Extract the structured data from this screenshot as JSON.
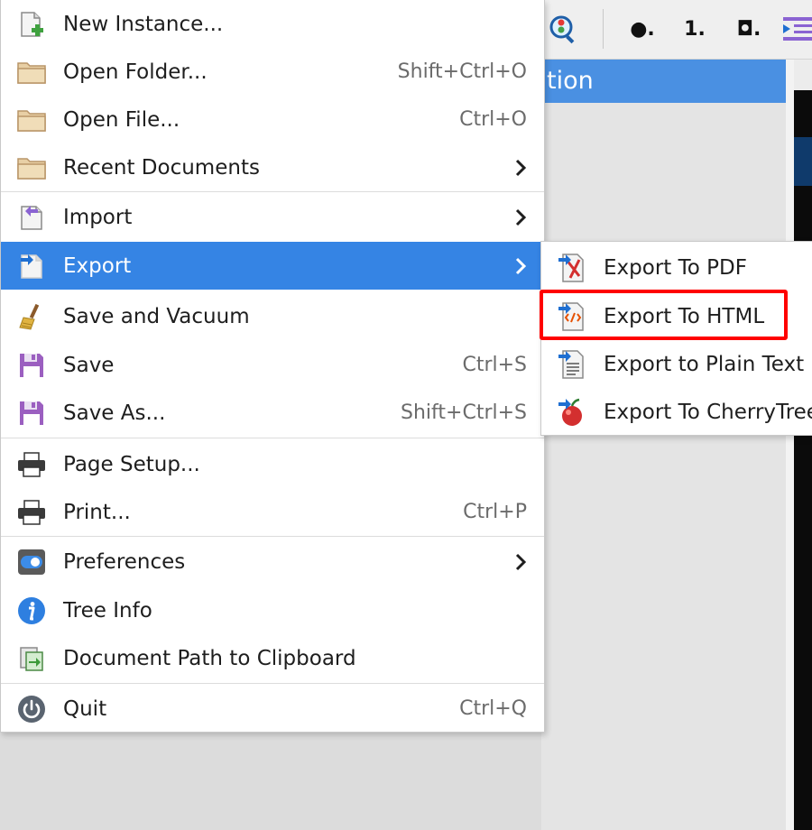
{
  "background": {
    "tree_header_text": "tion",
    "toolbar_icons": [
      "bullet-list-icon",
      "numbered-list-icon",
      "todo-list-icon",
      "indent-icon"
    ],
    "toolbar_glyphs": {
      "bullet": "●.",
      "numbered": "1.",
      "todo": "◘."
    }
  },
  "menu": {
    "items": [
      {
        "label": "New Instance...",
        "accel": "",
        "icon": "new-instance-icon"
      },
      {
        "label": "Open Folder...",
        "accel": "Shift+Ctrl+O",
        "icon": "folder-icon"
      },
      {
        "label": "Open File...",
        "accel": "Ctrl+O",
        "icon": "folder-icon"
      },
      {
        "label": "Recent Documents",
        "accel": "",
        "icon": "folder-icon",
        "submenu": true
      },
      {
        "label": "Import",
        "accel": "",
        "icon": "import-icon",
        "submenu": true
      },
      {
        "label": "Export",
        "accel": "",
        "icon": "export-icon",
        "submenu": true,
        "active": true
      },
      {
        "label": "Save and Vacuum",
        "accel": "",
        "icon": "broom-icon"
      },
      {
        "label": "Save",
        "accel": "Ctrl+S",
        "icon": "floppy-disk-icon"
      },
      {
        "label": "Save As...",
        "accel": "Shift+Ctrl+S",
        "icon": "floppy-disk-icon"
      },
      {
        "label": "Page Setup...",
        "accel": "",
        "icon": "printer-icon"
      },
      {
        "label": "Print...",
        "accel": "Ctrl+P",
        "icon": "printer-icon"
      },
      {
        "label": "Preferences",
        "accel": "",
        "icon": "preferences-toggle-icon",
        "submenu": true
      },
      {
        "label": "Tree Info",
        "accel": "",
        "icon": "info-icon"
      },
      {
        "label": "Document Path to Clipboard",
        "accel": "",
        "icon": "clipboard-icon"
      },
      {
        "label": "Quit",
        "accel": "Ctrl+Q",
        "icon": "power-icon"
      }
    ]
  },
  "export_submenu": {
    "items": [
      {
        "label": "Export To PDF",
        "icon": "export-pdf-icon"
      },
      {
        "label": "Export To HTML",
        "icon": "export-html-icon",
        "highlighted": true
      },
      {
        "label": "Export to Plain Text",
        "icon": "export-text-icon"
      },
      {
        "label": "Export To CherryTree",
        "icon": "export-cherrytree-icon"
      }
    ]
  },
  "colors": {
    "selection": "#3584e4",
    "highlight_box": "#ff0000",
    "tree_header": "#4a90e2"
  }
}
